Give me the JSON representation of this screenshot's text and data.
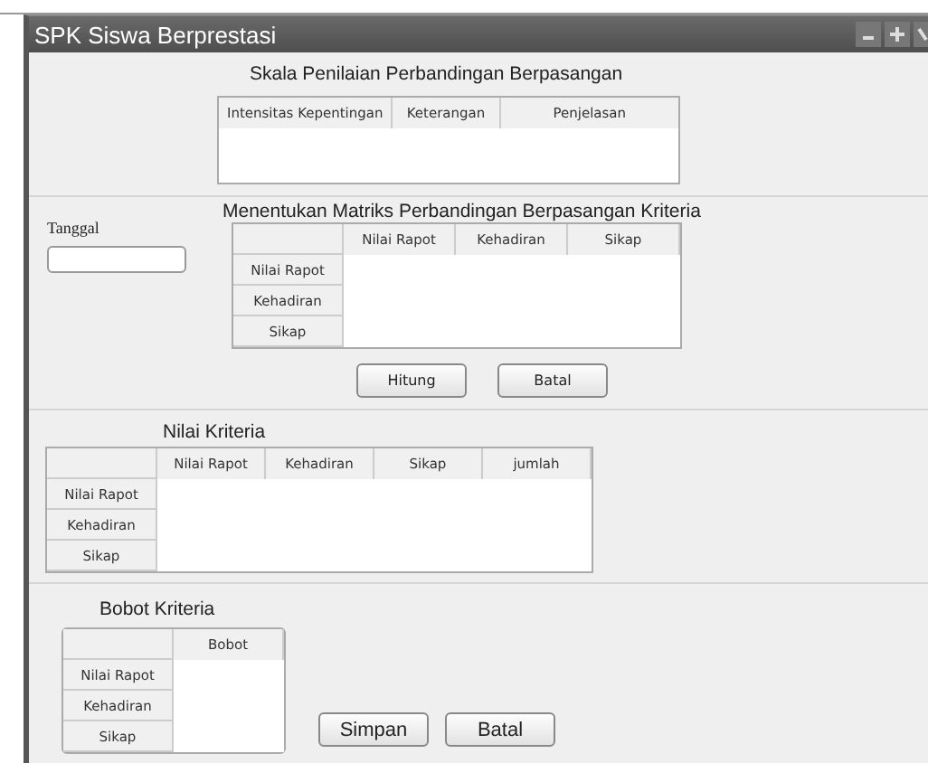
{
  "window": {
    "title": "SPK Siswa Berprestasi"
  },
  "scale_section": {
    "title": "Skala Penilaian Perbandingan Berpasangan",
    "columns": [
      "Intensitas Kepentingan",
      "Keterangan",
      "Penjelasan"
    ]
  },
  "matrix_section": {
    "date_label": "Tanggal",
    "title": "Menentukan Matriks Perbandingan Berpasangan Kriteria",
    "columns": [
      "Nilai Rapot",
      "Kehadiran",
      "Sikap"
    ],
    "row_headers": [
      "Nilai Rapot",
      "Kehadiran",
      "Sikap"
    ],
    "buttons": [
      "Hitung",
      "Batal"
    ]
  },
  "criteria_values": {
    "title": "Nilai Kriteria",
    "columns": [
      "Nilai Rapot",
      "Kehadiran",
      "Sikap",
      "jumlah"
    ],
    "row_headers": [
      "Nilai Rapot",
      "Kehadiran",
      "Sikap"
    ]
  },
  "criteria_weights": {
    "title": "Bobot Kriteria",
    "columns": [
      "Bobot"
    ],
    "row_headers": [
      "Nilai Rapot",
      "Kehadiran",
      "Sikap"
    ],
    "buttons": [
      "Simpan",
      "Batal"
    ]
  }
}
